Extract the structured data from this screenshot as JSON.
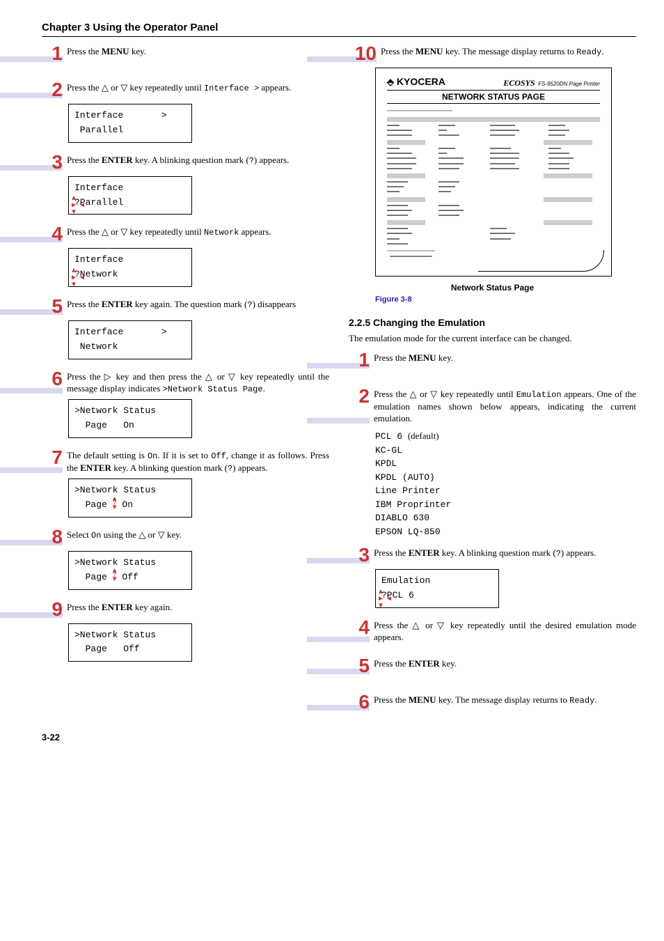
{
  "chapter": "Chapter 3  Using the Operator Panel",
  "pageNumber": "3-22",
  "left": {
    "s1": "Press the <b>MENU</b> key.",
    "s2": "Press the <span class='tri-up'></span> or <span class='tri-dn'></span> key repeatedly until <span class='mono'>Interface&nbsp;&gt;</span> appears.",
    "lcd2": "Interface       >\n Parallel",
    "s3": "Press the <b>ENTER</b> key. A blinking question mark (<span class='mono'>?</span>) appears.",
    "lcd3": "Interface\n?Parallel",
    "s4": "Press the <span class='tri-up'></span> or <span class='tri-dn'></span> key repeatedly until <span class='mono'>Network</span> appears.",
    "lcd4": "Interface\n?Network",
    "s5": "Press the <b>ENTER</b> key again. The question mark (<span class='mono'>?</span>) disappears",
    "lcd5": "Interface       >\n Network",
    "s6": "Press the <span class='tri-rt'></span> key and then press the <span class='tri-up'></span> or <span class='tri-dn'></span> key repeatedly until the message display indicates <span class='mono'>&gt;Network Status Page</span>.",
    "lcd6": ">Network Status\n  Page   On",
    "s7": "The default setting is <span class='mono'>On</span>. If it is set to <span class='mono'>Off</span>, change it as follows. Press the <b>ENTER</b> key. A blinking question mark (<span class='mono'>?</span>) appears.",
    "lcd7a": ">Network Status",
    "lcd7b": "  Page ",
    "lcd7c": " On",
    "s8": "Select <span class='mono'>On</span> using the <span class='tri-up'></span> or <span class='tri-dn'></span> key.",
    "lcd8a": ">Network Status",
    "lcd8b": "  Page ",
    "lcd8c": " Off",
    "s9": "Press the <b>ENTER</b> key again.",
    "lcd9": ">Network Status\n  Page   Off"
  },
  "right": {
    "s10": "Press the <b>MENU</b> key. The message display returns to <span class='mono'>Ready</span>.",
    "nsp": {
      "logo": "KYOCERA",
      "eco": "ECOSYS",
      "model": "FS-9520DN  Page Printer",
      "title": "NETWORK STATUS PAGE",
      "caption": "Network Status Page",
      "figLabel": "Figure 3-8"
    },
    "sectionTitle": "2.2.5 Changing the Emulation",
    "sectionIntro": "The emulation mode for the current interface can be changed.",
    "e1": "Press the <b>MENU</b> key.",
    "e2": "Press the <span class='tri-up'></span> or <span class='tri-dn'></span> key repeatedly until <span class='mono'>Emulation</span> appears. One of the emulation names shown below appears, indicating the current emulation.",
    "emulList": "PCL 6 (default)\nKC-GL\nKPDL\nKPDL (AUTO)\nLine Printer\nIBM Proprinter\nDIABLO 630\nEPSON LQ-850",
    "e3": "Press the <b>ENTER</b> key. A blinking question mark (<span class='mono'>?</span>) appears.",
    "lcdE3": "Emulation\n?PCL 6",
    "e4": "Press the <span class='tri-up'></span> or <span class='tri-dn'></span> key repeatedly until the desired emulation mode appears.",
    "e5": "Press the <b>ENTER</b> key.",
    "e6": "Press the <b>MENU</b> key. The message display returns to <span class='mono'>Ready</span>."
  }
}
